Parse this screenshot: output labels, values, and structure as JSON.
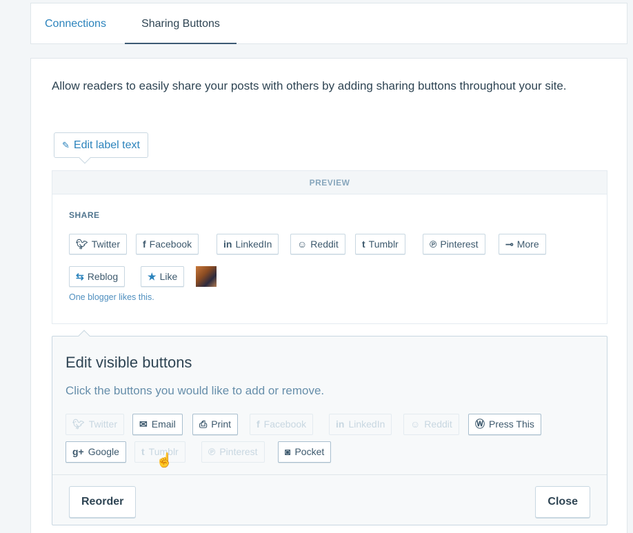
{
  "tabs": {
    "connections": "Connections",
    "sharing_buttons": "Sharing Buttons"
  },
  "intro_text": "Allow readers to easily share your posts with others by adding sharing buttons throughout your site.",
  "edit_label_text": "Edit label text",
  "preview": {
    "heading": "PREVIEW",
    "share_title": "SHARE",
    "buttons": [
      {
        "label": "Twitter",
        "icon": "twitter-icon"
      },
      {
        "label": "Facebook",
        "icon": "facebook-icon"
      },
      {
        "label": "LinkedIn",
        "icon": "linkedin-icon"
      },
      {
        "label": "Reddit",
        "icon": "reddit-icon"
      },
      {
        "label": "Tumblr",
        "icon": "tumblr-icon"
      },
      {
        "label": "Pinterest",
        "icon": "pinterest-icon"
      },
      {
        "label": "More",
        "icon": "more-icon"
      }
    ],
    "reblog_label": "Reblog",
    "like_label": "Like",
    "bloggers_text": "One blogger likes this."
  },
  "edit_panel": {
    "title": "Edit visible buttons",
    "subtitle": "Click the buttons you would like to add or remove.",
    "buttons": [
      {
        "label": "Twitter",
        "icon": "twitter-icon",
        "enabled": false
      },
      {
        "label": "Email",
        "icon": "email-icon",
        "enabled": true
      },
      {
        "label": "Print",
        "icon": "print-icon",
        "enabled": true
      },
      {
        "label": "Facebook",
        "icon": "facebook-icon",
        "enabled": false
      },
      {
        "label": "LinkedIn",
        "icon": "linkedin-icon",
        "enabled": false
      },
      {
        "label": "Reddit",
        "icon": "reddit-icon",
        "enabled": false
      },
      {
        "label": "Press This",
        "icon": "wordpress-icon",
        "enabled": true
      },
      {
        "label": "Google",
        "icon": "google-plus-icon",
        "enabled": true
      },
      {
        "label": "Tumblr",
        "icon": "tumblr-icon",
        "enabled": false
      },
      {
        "label": "Pinterest",
        "icon": "pinterest-icon",
        "enabled": false
      },
      {
        "label": "Pocket",
        "icon": "pocket-icon",
        "enabled": true
      }
    ],
    "reorder_label": "Reorder",
    "close_label": "Close"
  },
  "colors": {
    "accent": "#2b83bc",
    "text": "#2e4453",
    "muted": "#87a6bc"
  }
}
